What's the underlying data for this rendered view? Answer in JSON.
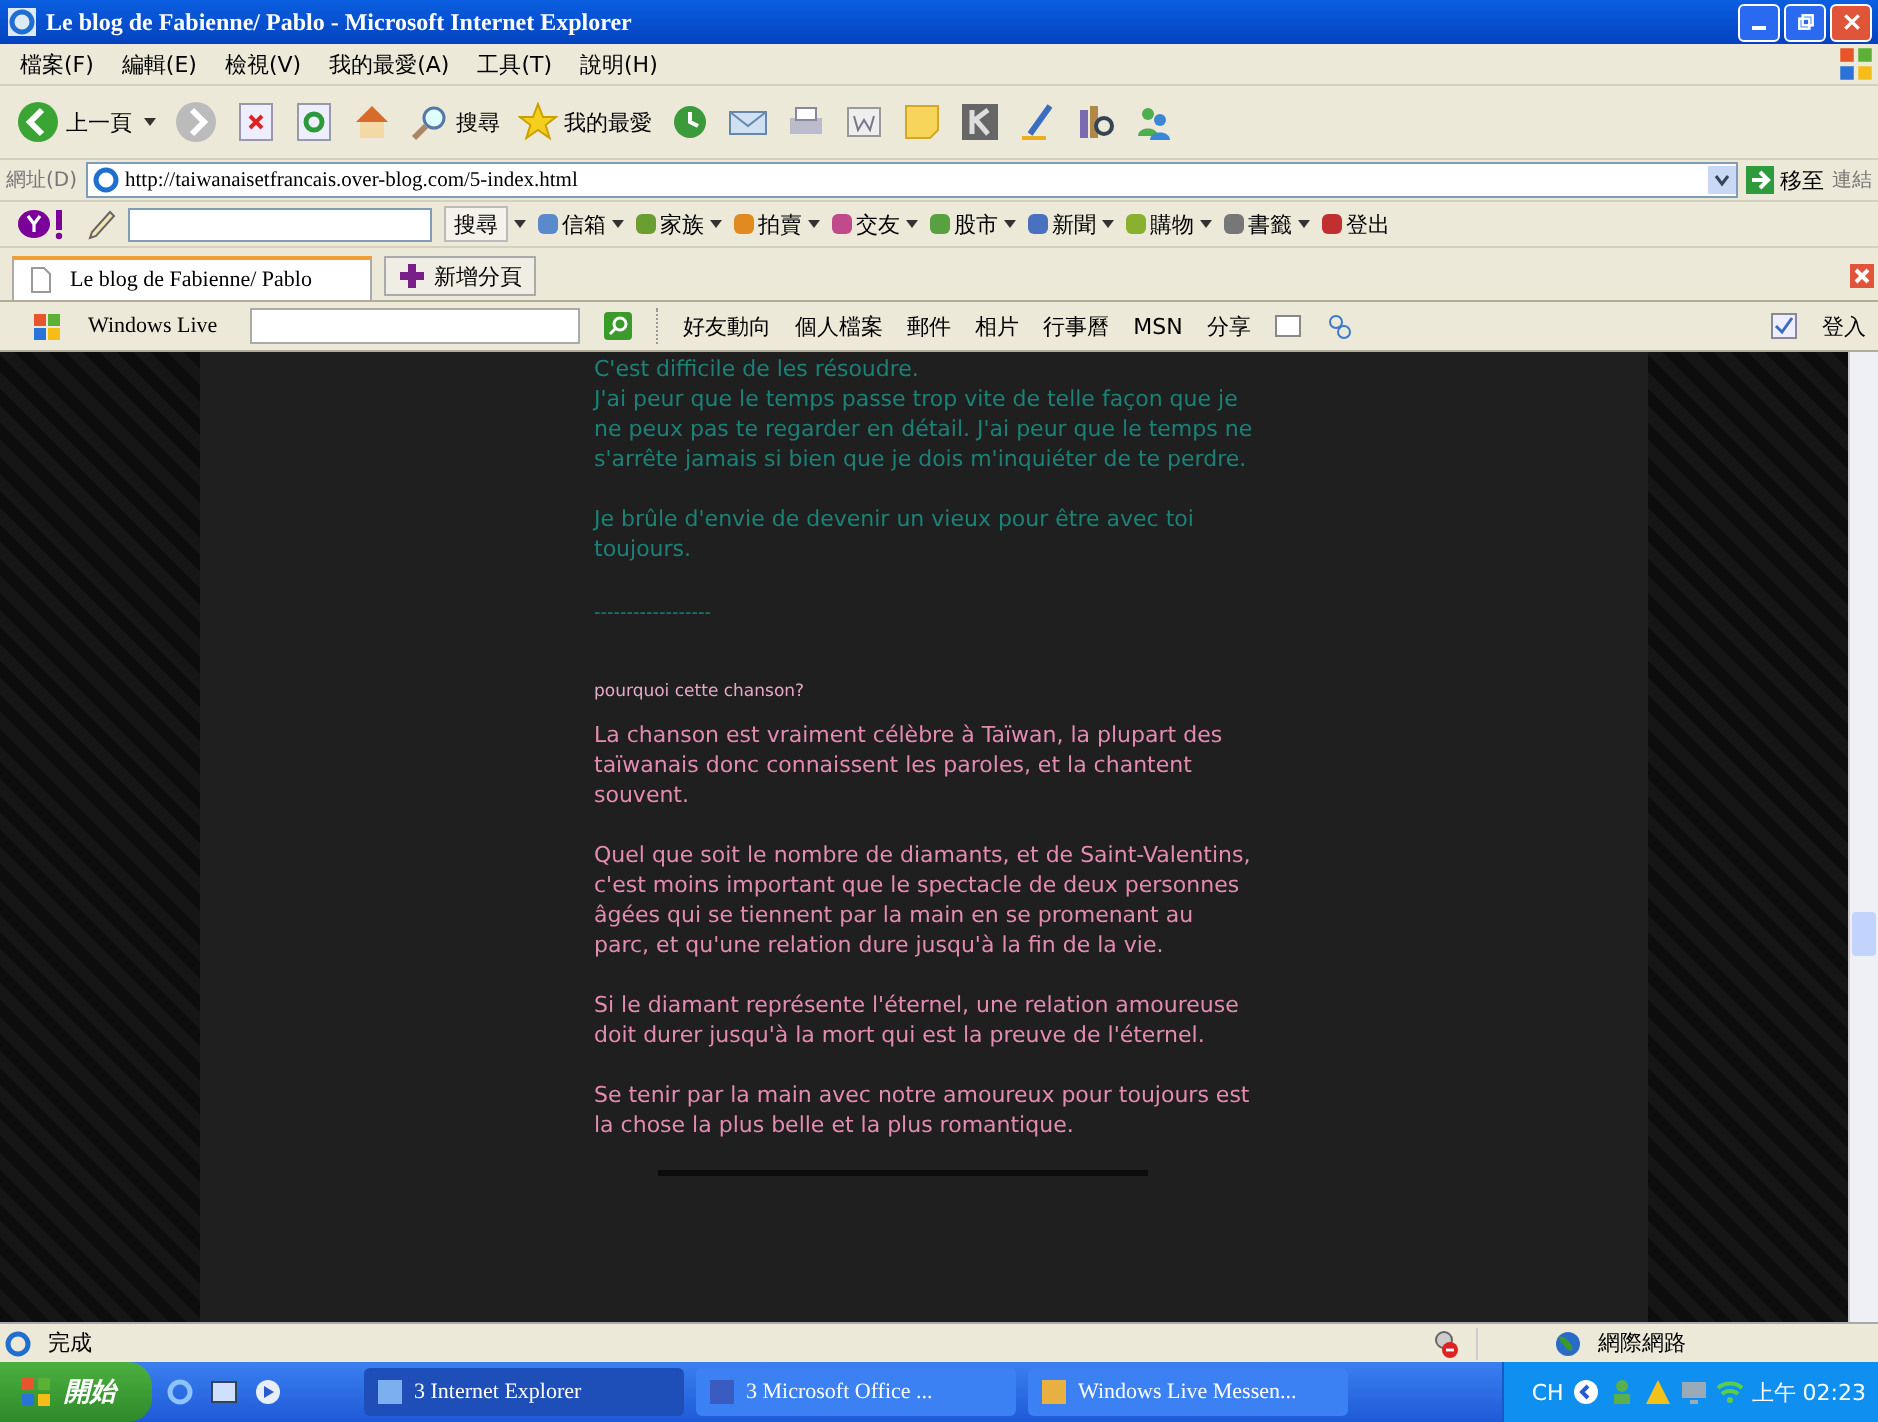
{
  "window": {
    "title": "Le blog de Fabienne/ Pablo - Microsoft Internet Explorer"
  },
  "menu_bar": [
    "檔案(F)",
    "編輯(E)",
    "檢視(V)",
    "我的最愛(A)",
    "工具(T)",
    "說明(H)"
  ],
  "toolbar": {
    "back": "上一頁",
    "search": "搜尋",
    "favorites": "我的最愛"
  },
  "address_bar": {
    "label": "網址(D)",
    "url": "http://taiwanaisetfrancais.over-blog.com/5-index.html",
    "go": "移至",
    "links": "連結"
  },
  "yahoo_bar": {
    "search_button": "搜尋",
    "items": [
      "信箱",
      "家族",
      "拍賣",
      "交友",
      "股市",
      "新聞",
      "購物",
      "書籤",
      "登出"
    ]
  },
  "tabs": [
    {
      "label": "Le blog de Fabienne/ Pablo",
      "selected": true
    }
  ],
  "new_tab": "新增分頁",
  "live_bar": {
    "brand": "Windows Live",
    "links": [
      "好友動向",
      "個人檔案",
      "郵件",
      "相片",
      "行事曆",
      "MSN",
      "分享"
    ],
    "sign_in": "登入"
  },
  "article": [
    {
      "kind": "lyrics",
      "text": "C'est difficile de les résoudre.\nJ'ai peur que le temps passe trop vite de telle façon que je ne peux pas te regarder en détail. J'ai peur que le temps ne s'arrête jamais si bien que je dois m'inquiéter de te perdre."
    },
    {
      "kind": "lyrics",
      "text": "Je brûle d'envie de devenir un vieux pour être avec toi toujours."
    },
    {
      "kind": "separator",
      "text": "------------------"
    },
    {
      "kind": "heading",
      "text": "pourquoi cette chanson?"
    },
    {
      "kind": "body",
      "text": "La chanson est vraiment célèbre à Taïwan, la plupart des taïwanais donc connaissent les paroles, et la chantent souvent."
    },
    {
      "kind": "body",
      "text": "Quel que soit le nombre de diamants, et de Saint-Valentins, c'est moins important que le spectacle de deux personnes âgées qui se tiennent par la main en se promenant au parc, et qu'une relation dure jusqu'à la fin de la vie."
    },
    {
      "kind": "body",
      "text": "Si le diamant représente l'éternel, une relation amoureuse doit durer jusqu'à la mort qui est la preuve de l'éternel."
    },
    {
      "kind": "body",
      "text": "Se tenir par la main avec notre amoureux pour toujours est la chose la plus belle et la plus romantique."
    }
  ],
  "status_bar": {
    "text": "完成",
    "zone": "網際網路"
  },
  "taskbar": {
    "start": "開始",
    "buttons": [
      {
        "label": "3 Internet Explorer",
        "selected": true
      },
      {
        "label": "3 Microsoft Office ...",
        "selected": false
      },
      {
        "label": "Windows Live Messen...",
        "selected": false
      }
    ],
    "language": "CH",
    "clock": "上午 02:23"
  }
}
